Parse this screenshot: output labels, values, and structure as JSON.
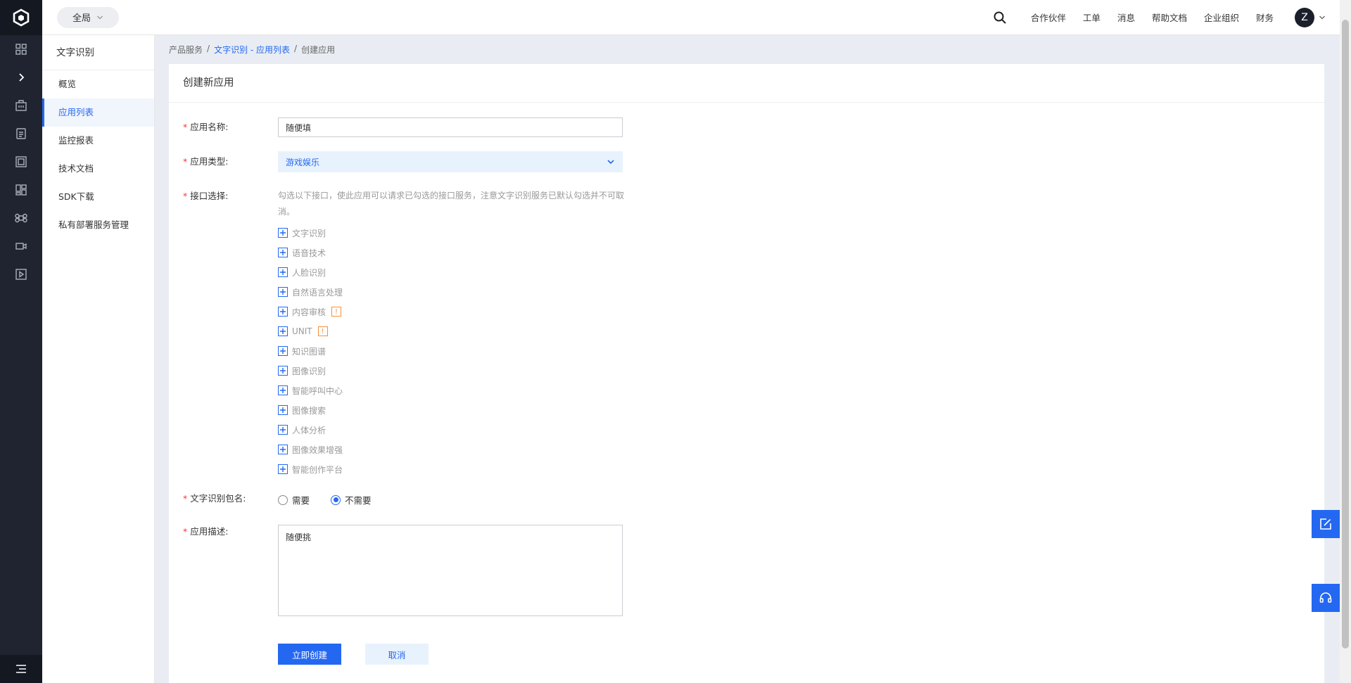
{
  "topbar": {
    "scope_label": "全局",
    "nav": [
      "合作伙伴",
      "工单",
      "消息",
      "帮助文档",
      "企业组织",
      "财务"
    ],
    "avatar_initial": "Z"
  },
  "sidebar": {
    "title": "文字识别",
    "items": [
      {
        "label": "概览",
        "active": false
      },
      {
        "label": "应用列表",
        "active": true
      },
      {
        "label": "监控报表",
        "active": false
      },
      {
        "label": "技术文档",
        "active": false
      },
      {
        "label": "SDK下载",
        "active": false
      },
      {
        "label": "私有部署服务管理",
        "active": false
      }
    ]
  },
  "breadcrumb": {
    "root": "产品服务",
    "sep": "/",
    "middle": "文字识别 - 应用列表",
    "current": "创建应用"
  },
  "form": {
    "title": "创建新应用",
    "required_mark": "*",
    "name_label": "应用名称:",
    "name_value": "随便填",
    "type_label": "应用类型:",
    "type_value": "游戏娱乐",
    "api_label": "接口选择:",
    "api_hint": "勾选以下接口，使此应用可以请求已勾选的接口服务，注意文字识别服务已默认勾选并不可取消。",
    "apis": [
      {
        "label": "文字识别",
        "badge": ""
      },
      {
        "label": "语音技术",
        "badge": ""
      },
      {
        "label": "人脸识别",
        "badge": ""
      },
      {
        "label": "自然语言处理",
        "badge": ""
      },
      {
        "label": "内容审核",
        "badge": "!"
      },
      {
        "label": "UNIT",
        "badge": "!"
      },
      {
        "label": "知识图谱",
        "badge": ""
      },
      {
        "label": "图像识别",
        "badge": ""
      },
      {
        "label": "智能呼叫中心",
        "badge": ""
      },
      {
        "label": "图像搜索",
        "badge": ""
      },
      {
        "label": "人体分析",
        "badge": ""
      },
      {
        "label": "图像效果增强",
        "badge": ""
      },
      {
        "label": "智能创作平台",
        "badge": ""
      }
    ],
    "package_label": "文字识别包名:",
    "package_options": [
      {
        "label": "需要",
        "checked": false
      },
      {
        "label": "不需要",
        "checked": true
      }
    ],
    "desc_label": "应用描述:",
    "desc_value": "随便挑",
    "submit_label": "立即创建",
    "cancel_label": "取消"
  },
  "colors": {
    "accent": "#2468f2",
    "rail_bg": "#1f2430",
    "badge": "#f78f3a"
  }
}
